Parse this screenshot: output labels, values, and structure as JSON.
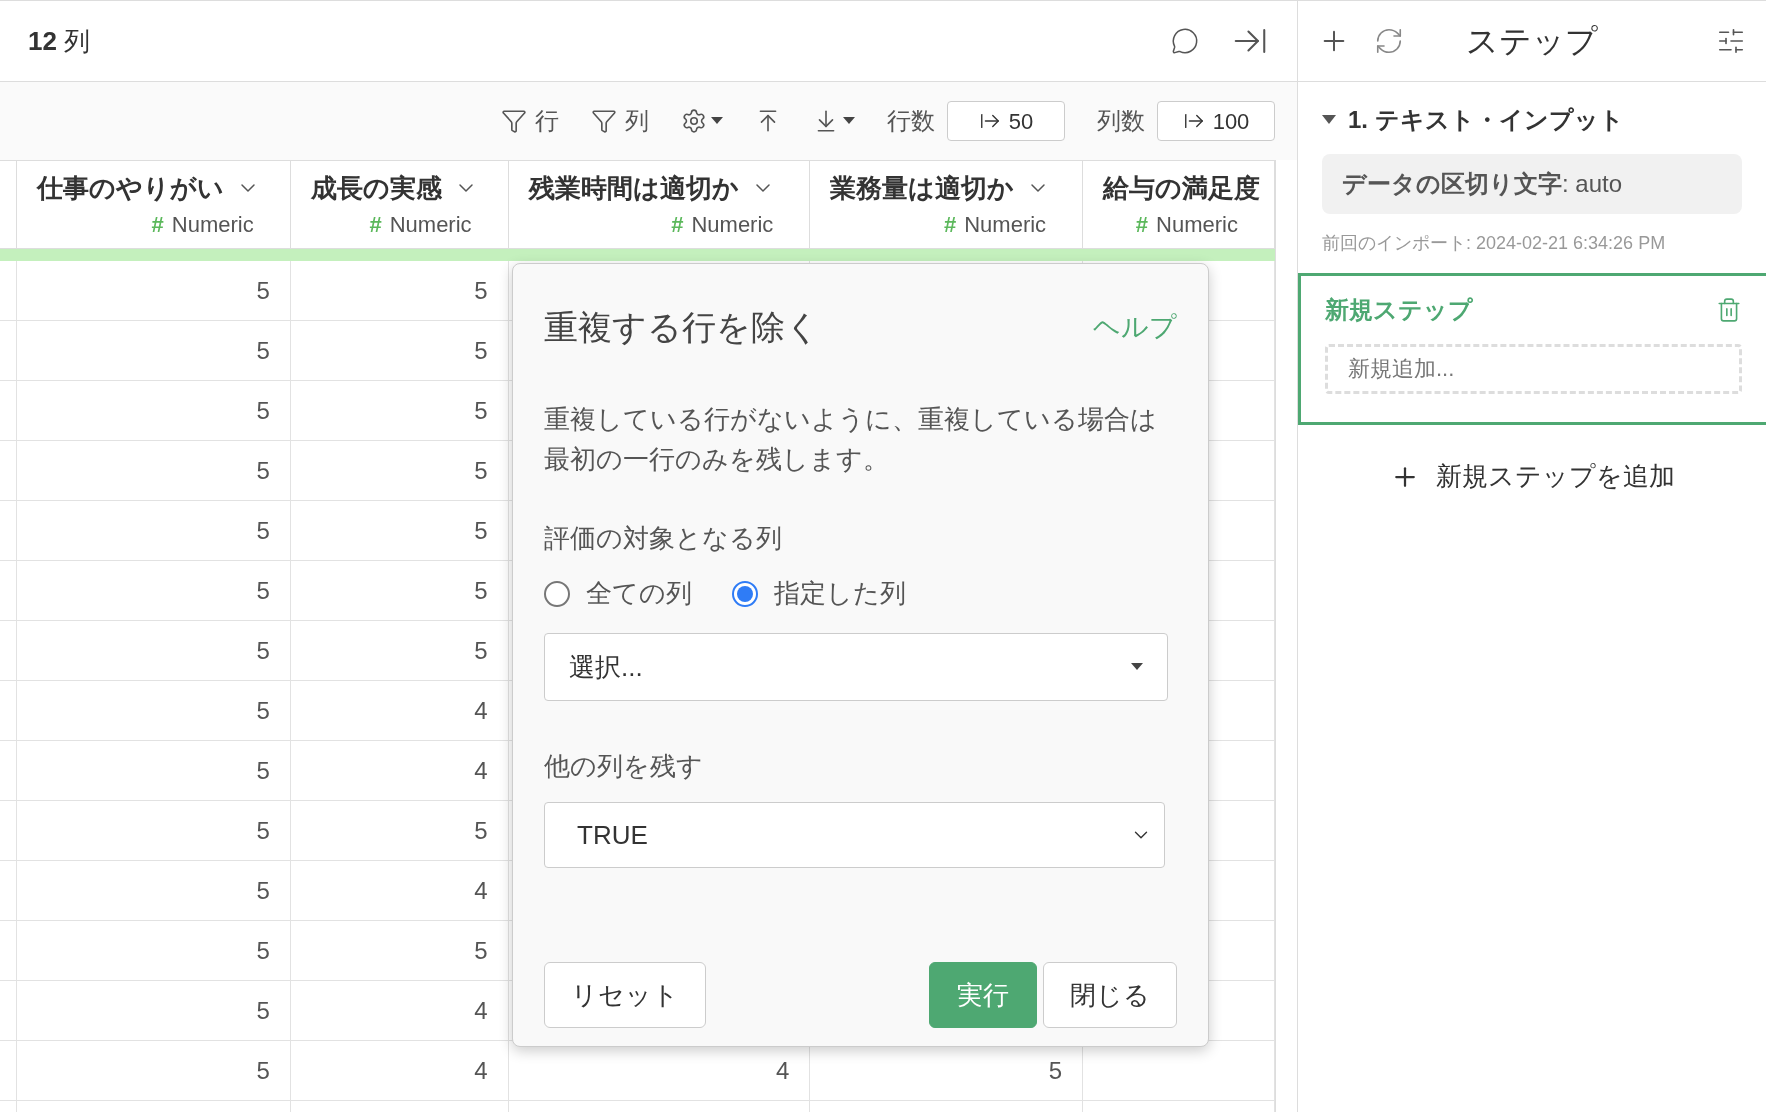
{
  "top_bar": {
    "column_count": "**12** 列"
  },
  "toolbar": {
    "items": [
      {
        "kind": "filter",
        "label": "行"
      },
      {
        "kind": "filter",
        "label": "列"
      },
      {
        "kind": "settings"
      },
      {
        "kind": "upload"
      },
      {
        "kind": "download"
      }
    ],
    "row_limit": {
      "label": "行数",
      "value": "50"
    },
    "column_limit": {
      "label": "列数",
      "value": "100"
    }
  },
  "table": {
    "columns": [
      {
        "name": "仕事のやりがい",
        "type_mark": "#",
        "type": "Numeric",
        "menu": true
      },
      {
        "name": "成長の実感",
        "type_mark": "#",
        "type": "Numeric",
        "menu": true
      },
      {
        "name": "残業時間は適切か",
        "type_mark": "#",
        "type": "Numeric",
        "menu": true
      },
      {
        "name": "業務量は適切か",
        "type_mark": "#",
        "type": "Numeric",
        "menu": true
      },
      {
        "name": "給与の満足度",
        "type_mark": "#",
        "type": "Numeric",
        "menu": false
      }
    ],
    "rows": [
      [
        "5",
        "5"
      ],
      [
        "5",
        "5"
      ],
      [
        "5",
        "5"
      ],
      [
        "5",
        "5"
      ],
      [
        "5",
        "5"
      ],
      [
        "5",
        "5"
      ],
      [
        "5",
        "5"
      ],
      [
        "5",
        "4"
      ],
      [
        "5",
        "4"
      ],
      [
        "5",
        "5"
      ],
      [
        "5",
        "4"
      ],
      [
        "5",
        "5"
      ],
      [
        "5",
        "4"
      ],
      [
        "5",
        "4",
        "4",
        "5"
      ]
    ]
  },
  "dialog": {
    "title": "重複する行を除く",
    "help": "ヘルプ",
    "description": "重複している行がないように、重複している場合は最初の一行のみを残します。",
    "target_label": "評価の対象となる列",
    "radios": [
      {
        "label": "全ての列",
        "selected": false
      },
      {
        "label": "指定した列",
        "selected": true
      }
    ],
    "column_select": {
      "placeholder": "選択..."
    },
    "keep_label": "他の列を残す",
    "keep_select": {
      "value": "TRUE"
    },
    "buttons": [
      {
        "kind": "reset",
        "label": "リセット"
      },
      {
        "kind": "primary",
        "label": "実行"
      },
      {
        "kind": "secondary",
        "label": "閉じる"
      }
    ]
  },
  "steps_panel": {
    "title": "ステップ",
    "steps": [
      {
        "title": "1. テキスト・インプット",
        "expanded": true,
        "detail": "**データの区切り文字**: auto",
        "meta": "前回のインポート: 2024-02-21 6:34:26 PM"
      }
    ],
    "new_step": {
      "title": "新規ステップ",
      "placeholder": "新規追加..."
    },
    "add_button": "新規ステップを追加"
  }
}
